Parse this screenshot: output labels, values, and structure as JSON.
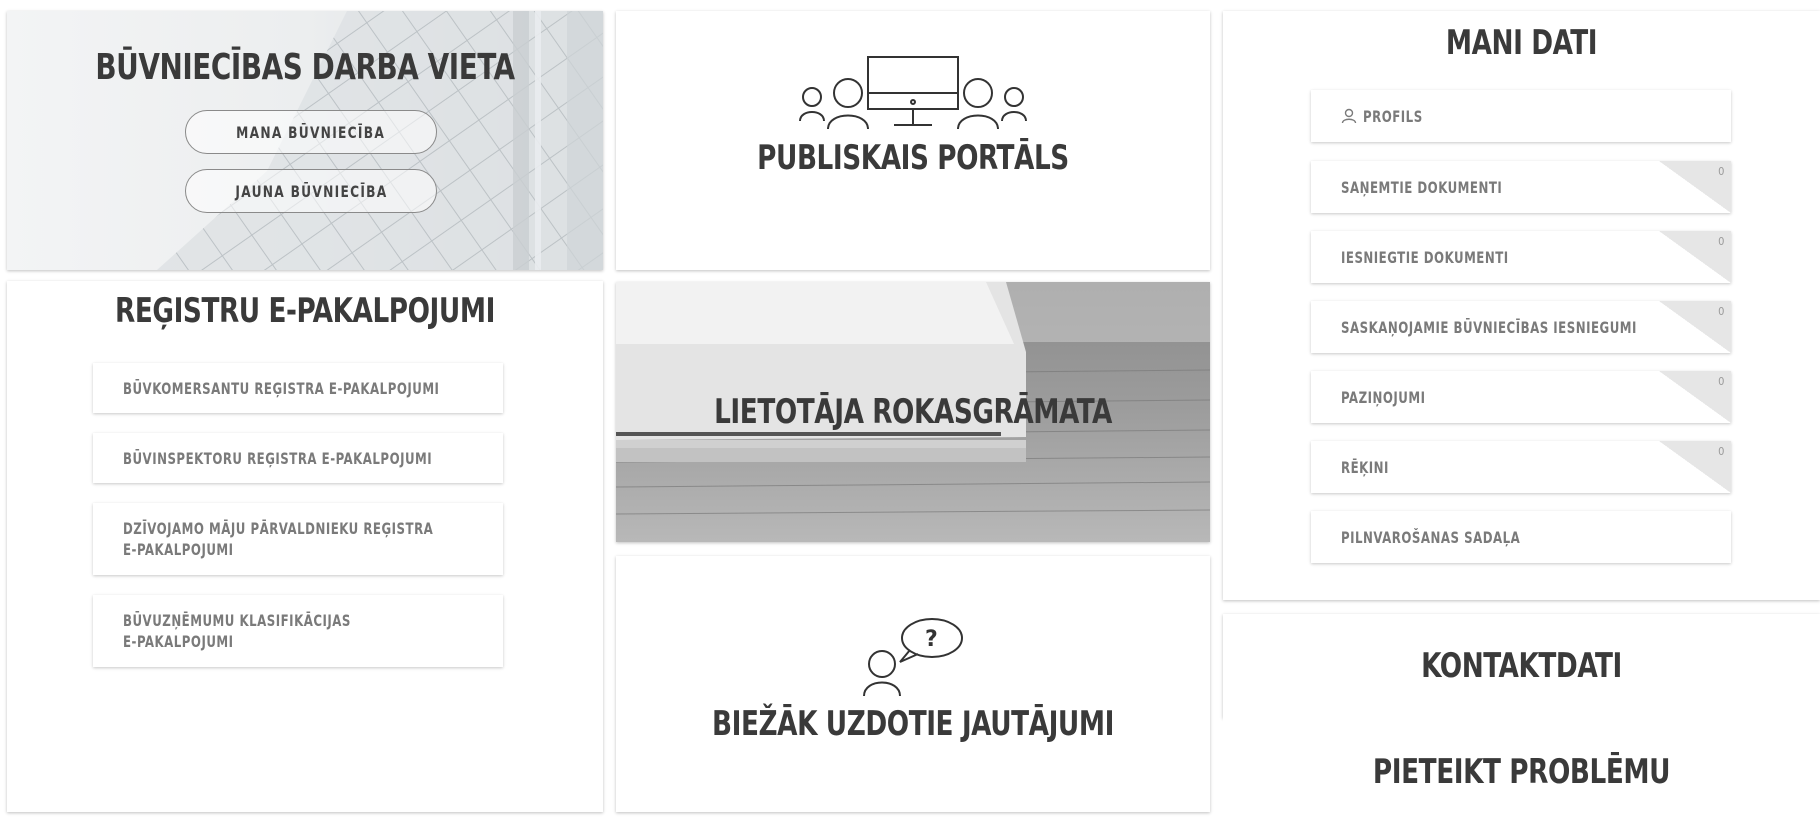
{
  "workplace": {
    "title": "BŪVNIECĪBAS DARBA VIETA",
    "buttons": [
      "MANA BŪVNIECĪBA",
      "JAUNA BŪVNIECĪBA"
    ]
  },
  "portal": {
    "title": "PUBLISKAIS PORTĀLS"
  },
  "registers": {
    "title": "REĢISTRU E-PAKALPOJUMI",
    "items": [
      "BŪVKOMERSANTU REĢISTRA E-PAKALPOJUMI",
      "BŪVINSPEKTORU REĢISTRA E-PAKALPOJUMI",
      "DZĪVOJAMO MĀJU PĀRVALDNIEKU REĢISTRA",
      "E-PAKALPOJUMI",
      "BŪVUZŅĒMUMU KLASIFIKĀCIJAS",
      "E-PAKALPOJUMI"
    ]
  },
  "manual": {
    "title": "LIETOTĀJA ROKASGRĀMATA"
  },
  "faq": {
    "title": "BIEŽĀK UZDOTIE JAUTĀJUMI"
  },
  "mydata": {
    "title": "MANI DATI",
    "profile": "PROFILS",
    "items": [
      {
        "label": "SAŅEMTIE DOKUMENTI",
        "count": "0"
      },
      {
        "label": "IESNIEGTIE DOKUMENTI",
        "count": "0"
      },
      {
        "label": "SASKAŅOJAMIE BŪVNIECĪBAS IESNIEGUMI",
        "count": "0"
      },
      {
        "label": "PAZIŅOJUMI",
        "count": "0"
      },
      {
        "label": "RĒĶINI",
        "count": "0"
      }
    ],
    "authorization": "PILNVAROŠANAS SADAĻA"
  },
  "contacts": {
    "title": "KONTAKTDATI"
  },
  "report": {
    "title": "PIETEIKT PROBLĒMU"
  },
  "icons": {
    "user": "user-icon",
    "presentation": "presentation-icon",
    "question": "question-bubble-icon",
    "book": "book-image",
    "building": "building-image"
  }
}
